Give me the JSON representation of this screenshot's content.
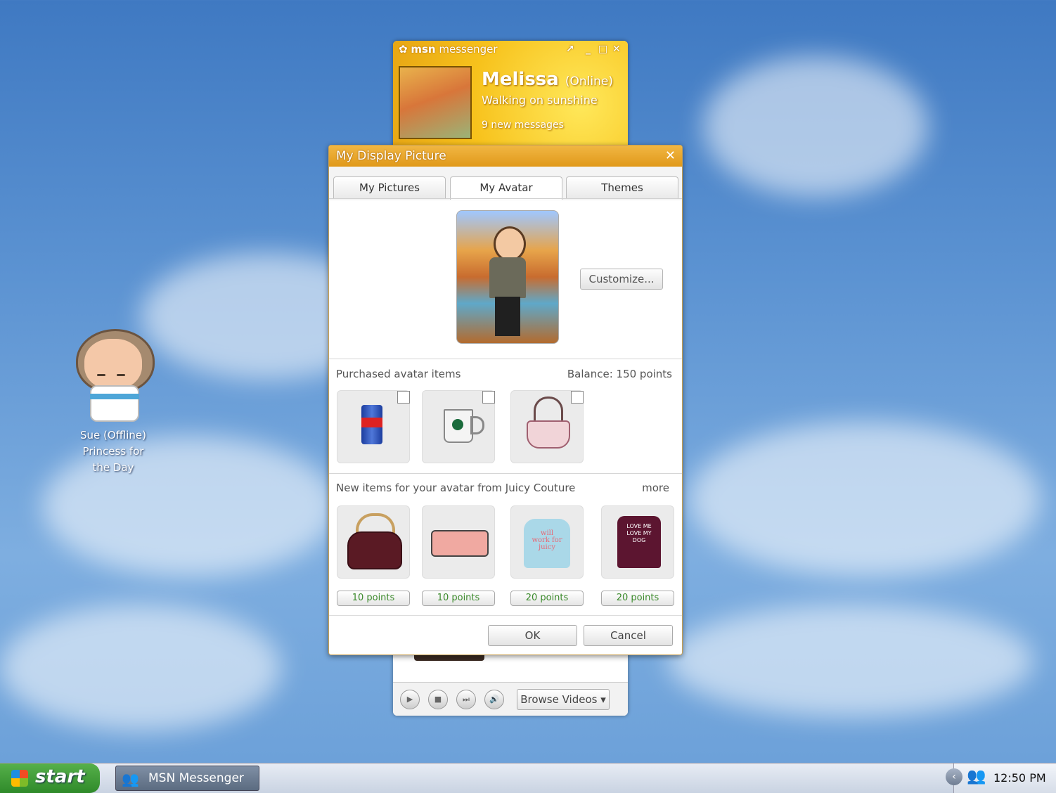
{
  "desktop": {
    "icon": {
      "line1": "Sue (Offline)",
      "line2": "Princess for",
      "line3": "the Day"
    }
  },
  "messenger": {
    "title_bold": "msn",
    "title_rest": " messenger",
    "controls": {
      "expand": "↗",
      "minimize": "_",
      "maximize": "□",
      "close": "✕"
    },
    "user_name": "Melissa",
    "user_status": "(Online)",
    "personal_message": "Walking on sunshine",
    "new_messages": "9 new messages",
    "browse_videos": "Browse Videos ▾",
    "media": {
      "play": "▶",
      "stop": "■",
      "next": "⏭",
      "volume": "🔊"
    }
  },
  "dialog": {
    "title": "My Display Picture",
    "close": "✕",
    "tabs": [
      "My Pictures",
      "My Avatar",
      "Themes"
    ],
    "customize_label": "Customize...",
    "purchased_label": "Purchased avatar items",
    "balance": "Balance: 150 points",
    "new_items_label": "New items for your avatar from Juicy Couture",
    "more_label": "more",
    "new_items": [
      {
        "points": "10 points"
      },
      {
        "points": "10 points"
      },
      {
        "points": "20 points"
      },
      {
        "points": "20 points"
      }
    ],
    "sweatshirt_text": "will work for juicy",
    "top_text": "LOVE ME LOVE MY DOG",
    "ok": "OK",
    "cancel": "Cancel"
  },
  "taskbar": {
    "start": "start",
    "task_label": "MSN Messenger",
    "tray_arrow": "‹",
    "clock": "12:50 PM"
  }
}
